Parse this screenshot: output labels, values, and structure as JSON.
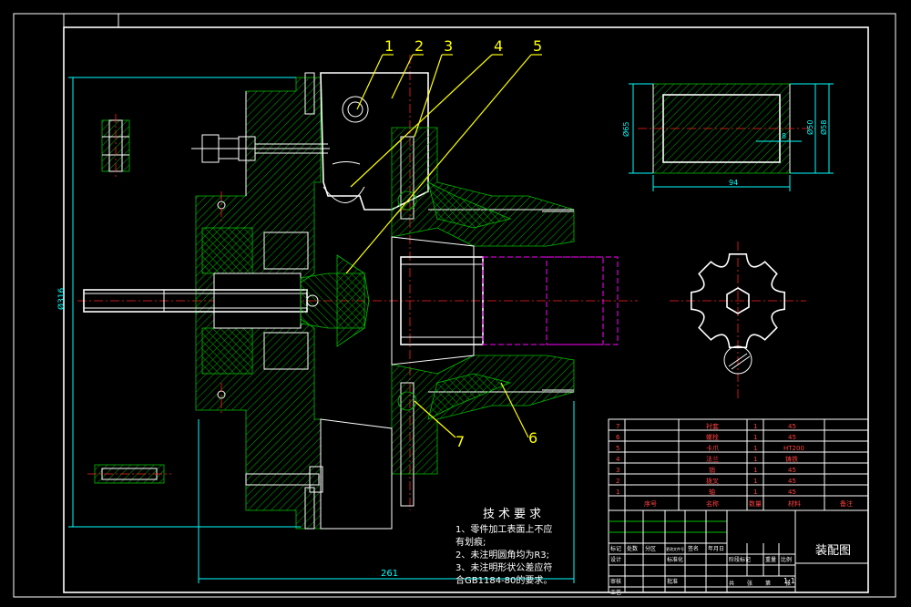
{
  "part_numbers": [
    "1",
    "2",
    "3",
    "4",
    "5",
    "6",
    "7"
  ],
  "dimensions": {
    "overall_length": "261",
    "left_height": "Ø316",
    "sleeve_length": "94",
    "sleeve_d1": "Ø65",
    "sleeve_d2": "Ø50",
    "sleeve_d3": "Ø58",
    "sleeve_small": "8"
  },
  "tech_requirements": {
    "title": "技术要求",
    "lines": [
      "1、零件加工表面上不应",
      "有划痕;",
      "2、未注明圆角均为R3;",
      "3、未注明形状公差应符",
      "合GB1184-80的要求。"
    ]
  },
  "bom": {
    "rows": [
      {
        "no": "7",
        "name": "衬套",
        "qty": "1",
        "material": "45"
      },
      {
        "no": "6",
        "name": "螺栓",
        "qty": "1",
        "material": "45"
      },
      {
        "no": "5",
        "name": "卡爪",
        "qty": "1",
        "material": "HT200"
      },
      {
        "no": "4",
        "name": "法兰",
        "qty": "1",
        "material": "铸铁"
      },
      {
        "no": "3",
        "name": "销",
        "qty": "1",
        "material": "45"
      },
      {
        "no": "2",
        "name": "拨叉",
        "qty": "1",
        "material": "45"
      },
      {
        "no": "1",
        "name": "轴",
        "qty": "1",
        "material": "45"
      }
    ],
    "header": {
      "no": "序号",
      "name": "名称",
      "qty": "数量",
      "material": "材料",
      "note": "备注"
    }
  },
  "title_block": {
    "drawing_title": "装配图",
    "scale": "1:1",
    "cells": [
      "标记",
      "处数",
      "分区",
      "更改文件号",
      "签名",
      "年月日",
      "设计",
      "标准化",
      "审核",
      "工艺",
      "批准",
      "阶段标记",
      "重量",
      "比例",
      "共",
      "张",
      "第",
      "张"
    ]
  },
  "colors": {
    "background": "#000000",
    "outline": "#ffffff",
    "hatch": "#00c000",
    "leader": "#ffff00",
    "annotation": "#00ffff",
    "centerline": "#ff2020",
    "phantom": "#ff00ff"
  }
}
